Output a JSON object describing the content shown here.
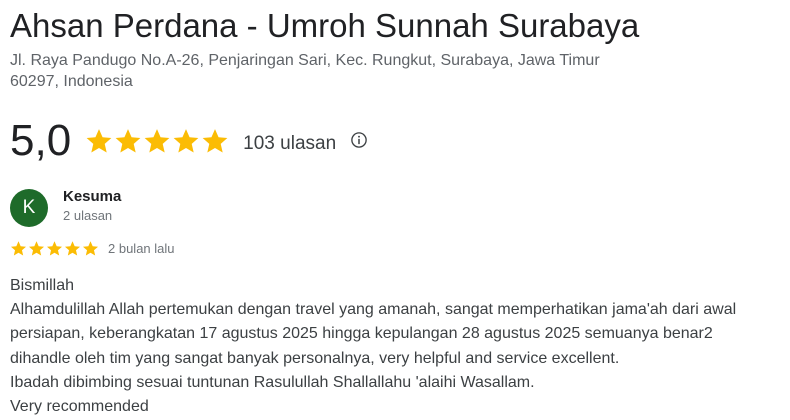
{
  "place": {
    "title": "Ahsan Perdana - Umroh Sunnah Surabaya",
    "address_line1": "Jl. Raya Pandugo No.A-26, Penjaringan Sari, Kec. Rungkut, Surabaya, Jawa Timur",
    "address_line2": "60297, Indonesia"
  },
  "rating": {
    "score": "5,0",
    "stars": 5,
    "count_label": "103 ulasan",
    "info_icon": "info-circle-icon",
    "star_color": "#fbbc04"
  },
  "review": {
    "avatar_letter": "K",
    "avatar_color": "#1e6b2a",
    "name": "Kesuma",
    "meta": "2 ulasan",
    "stars": 5,
    "date": "2 bulan lalu",
    "lines": [
      "Bismillah",
      "Alhamdulillah Allah pertemukan dengan travel yang amanah, sangat memperhatikan jama'ah dari awal",
      "persiapan, keberangkatan 17 agustus 2025 hingga kepulangan 28 agustus 2025 semuanya benar2",
      "dihandle oleh tim yang sangat banyak personalnya, very helpful and service excellent.",
      "Ibadah dibimbing sesuai tuntunan Rasulullah Shallallahu 'alaihi Wasallam.",
      "Very recommended"
    ]
  }
}
